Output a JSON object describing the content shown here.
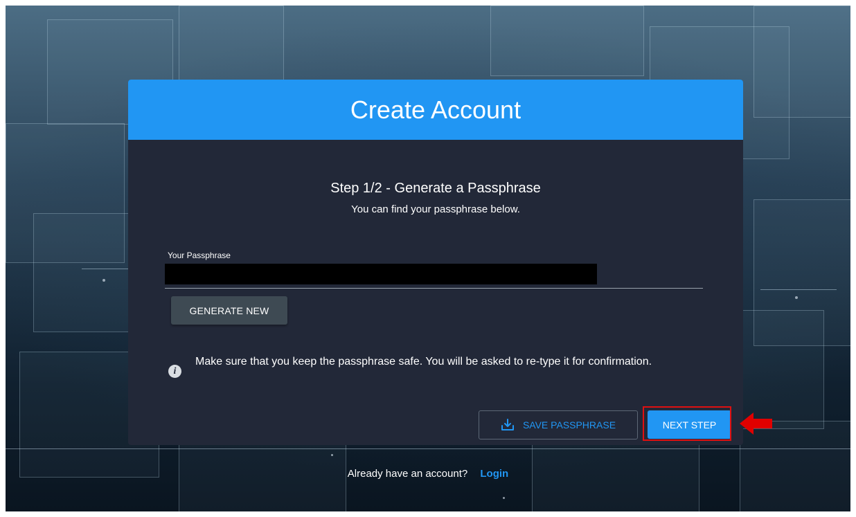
{
  "card": {
    "title": "Create Account",
    "step_title": "Step 1/2 - Generate a Passphrase",
    "step_subtitle": "You can find your passphrase below."
  },
  "passphrase": {
    "label": "Your Passphrase",
    "value": ""
  },
  "buttons": {
    "generate_new": "GENERATE NEW",
    "save_passphrase": "SAVE PASSPHRASE",
    "next_step": "NEXT STEP"
  },
  "info": {
    "icon": "info-icon",
    "text": "Make sure that you keep the passphrase safe. You will be asked to re-type it for confirmation."
  },
  "footer": {
    "prompt": "Already have an account?",
    "login_link": "Login"
  },
  "colors": {
    "accent": "#2196f3",
    "card_bg": "#222838",
    "highlight": "#e01010"
  }
}
